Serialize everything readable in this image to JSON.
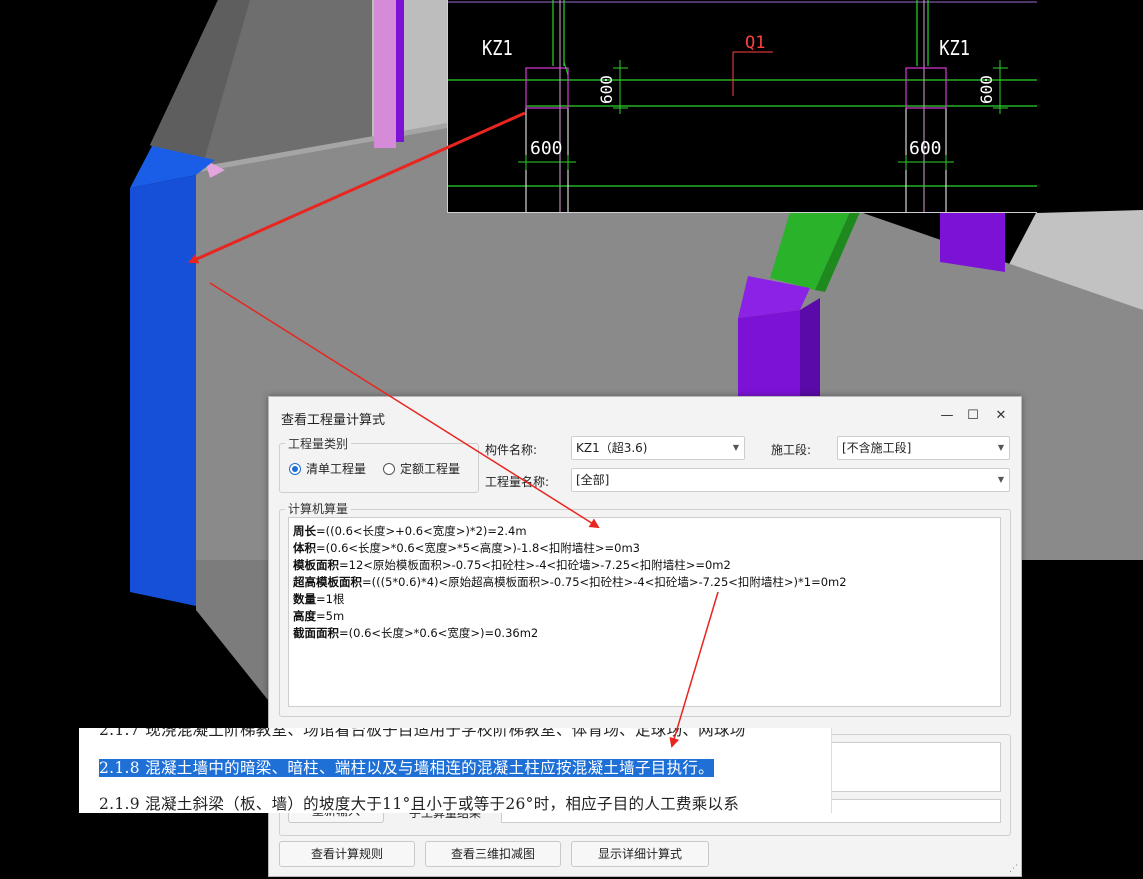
{
  "cad": {
    "col_label_left": "KZ1",
    "col_label_right": "KZ1",
    "wall_label": "Q1",
    "dim_left_h": "600",
    "dim_left_v": "600",
    "dim_right_h": "600",
    "dim_right_v": "600"
  },
  "dialog": {
    "title": "查看工程量计算式",
    "window_controls": {
      "minimize": "—",
      "maximize": "☐",
      "close": "✕"
    },
    "quantity_type": {
      "legend": "工程量类别",
      "options": [
        {
          "label": "清单工程量",
          "selected": true
        },
        {
          "label": "定额工程量",
          "selected": false
        }
      ]
    },
    "component_name": {
      "label": "构件名称:",
      "value": "KZ1（超3.6)"
    },
    "construction_section": {
      "label": "施工段:",
      "value": "[不含施工段]"
    },
    "quantity_name": {
      "label": "工程量名称:",
      "value": "[全部]"
    },
    "computer_calc": {
      "legend": "计算机算量",
      "lines": [
        {
          "name": "周长",
          "formula": "=((0.6<长度>+0.6<宽度>)*2)=2.4m"
        },
        {
          "name": "体积",
          "formula": "=(0.6<长度>*0.6<宽度>*5<高度>)-1.8<扣附墙柱>=0m3"
        },
        {
          "name": "模板面积",
          "formula": "=12<原始模板面积>-0.75<扣砼柱>-4<扣砼墙>-7.25<扣附墙柱>=0m2"
        },
        {
          "name": "超高模板面积",
          "formula": "=(((5*0.6)*4)<原始超高模板面积>-0.75<扣砼柱>-4<扣砼墙>-7.25<扣附墙柱>)*1=0m2"
        },
        {
          "name": "数量",
          "formula": "=1根"
        },
        {
          "name": "高度",
          "formula": "=5m"
        },
        {
          "name": "截面面积",
          "formula": "=(0.6<长度>*0.6<宽度>)=0.36m2"
        }
      ]
    },
    "buttons": {
      "view_rules": "查看计算规则",
      "view_3d": "查看三维扣减图",
      "show_detail": "显示详细计算式"
    },
    "partial_button": "重新输入",
    "partial_label": "手工算量结果"
  },
  "document": {
    "line_top": "2.1.7 现浇混凝土阶梯教室、场馆看台板子目适用于学校阶梯教室、体育场、足球场、网球场",
    "line_selected": "2.1.8 混凝土墙中的暗梁、暗柱、端柱以及与墙相连的混凝土柱应按混凝土墙子目执行。",
    "line_bottom": "2.1.9 混凝土斜梁（板、墙）的坡度大于11°且小于或等于26°时，相应子目的人工费乘以系"
  },
  "colors": {
    "column_blue": "#1650d8",
    "column_purple": "#7b12d6",
    "column_pink": "#d58bd8",
    "beam_green": "#2ab32a",
    "arrow_red": "#e8251f",
    "selection_blue": "#1f70d6"
  }
}
